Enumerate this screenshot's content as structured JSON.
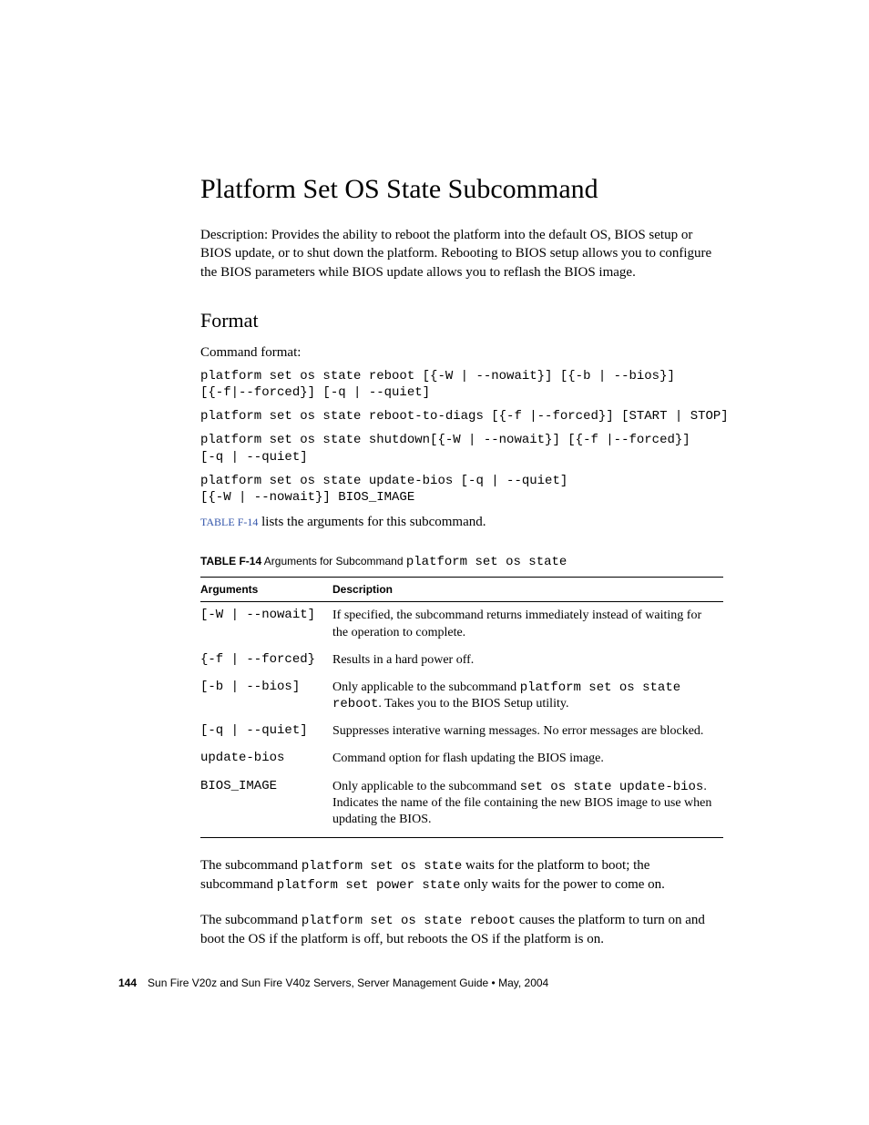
{
  "heading": "Platform Set OS State Subcommand",
  "description": "Description: Provides the ability to reboot the platform into the default OS, BIOS setup or BIOS update, or to shut down the platform. Rebooting to BIOS setup allows you to configure the BIOS parameters while BIOS update allows you to reflash the BIOS image.",
  "format_heading": "Format",
  "format_label": "Command format:",
  "code": {
    "line1": "platform set os state reboot [{-W | --nowait}] [{-b | --bios}]\n[{-f|--forced}] [-q | --quiet]",
    "line2": "platform set os state reboot-to-diags [{-f |--forced}] [START | STOP]",
    "line3": "platform set os state shutdown[{-W | --nowait}] [{-f |--forced}]\n[-q | --quiet]",
    "line4": "platform set os state update-bios [-q | --quiet]\n[{-W | --nowait}] BIOS_IMAGE"
  },
  "ref_sentence": {
    "link": "TABLE F-14",
    "rest": " lists the arguments for this subcommand."
  },
  "table_caption": {
    "lead": "TABLE F-14",
    "mid": "   Arguments for Subcommand ",
    "code": "platform set os state"
  },
  "table": {
    "head_arg": "Arguments",
    "head_desc": "Description",
    "rows": [
      {
        "arg": "[-W | --nowait]",
        "desc_pre": "If specified, the subcommand returns immediately instead of waiting for the operation to complete.",
        "mono": "",
        "desc_post": ""
      },
      {
        "arg": "{-f | --forced}",
        "desc_pre": "Results in a hard power off.",
        "mono": "",
        "desc_post": ""
      },
      {
        "arg": "[-b | --bios]",
        "desc_pre": "Only applicable to the subcommand ",
        "mono": "platform set os state reboot",
        "desc_post": ". Takes you to the BIOS Setup utility."
      },
      {
        "arg": "[-q | --quiet]",
        "desc_pre": "Suppresses interative warning messages. No error messages are blocked.",
        "mono": "",
        "desc_post": ""
      },
      {
        "arg": "update-bios",
        "desc_pre": "Command option for flash updating the BIOS image.",
        "mono": "",
        "desc_post": ""
      },
      {
        "arg": "BIOS_IMAGE",
        "desc_pre": "Only applicable to the subcommand ",
        "mono": "set os state update-bios",
        "desc_post": ". Indicates the name of the file containing the new BIOS image to use when updating the BIOS."
      }
    ]
  },
  "para1": {
    "t1": "The subcommand ",
    "c1": "platform set os state",
    "t2": " waits for the platform to boot; the subcommand ",
    "c2": "platform set power state",
    "t3": " only waits for the power to come on."
  },
  "para2": {
    "t1": "The subcommand ",
    "c1": "platform set os state reboot",
    "t2": " causes the platform to turn on and boot the OS if the platform is off, but reboots the OS if the platform is on."
  },
  "footer": {
    "page": "144",
    "text": "Sun Fire V20z and Sun Fire V40z Servers, Server Management Guide • May, 2004"
  }
}
